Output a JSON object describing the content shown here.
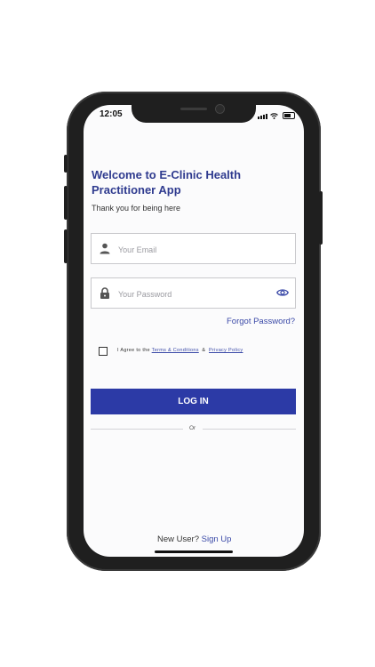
{
  "status_bar": {
    "time": "12:05"
  },
  "welcome": {
    "title": "Welcome to E-Clinic Health Practitioner App",
    "subtitle": "Thank you for being here"
  },
  "form": {
    "email_placeholder": "Your Email",
    "password_placeholder": "Your Password",
    "forgot_password": "Forgot Password?",
    "agree_prefix": "I Agree to the",
    "terms_link": "Terms & Conditions",
    "agree_joiner": "&",
    "privacy_link": "Privacy Policy",
    "login_label": "LOG IN",
    "or_text": "Or"
  },
  "footer": {
    "new_user": "New User?",
    "sign_up": "Sign Up"
  },
  "colors": {
    "accent": "#2c3aa6",
    "title": "#2f3b8f",
    "link": "#3b4aa8"
  },
  "icons": [
    "person-icon",
    "lock-icon",
    "eye-icon",
    "signal-icon",
    "wifi-icon",
    "battery-icon"
  ]
}
